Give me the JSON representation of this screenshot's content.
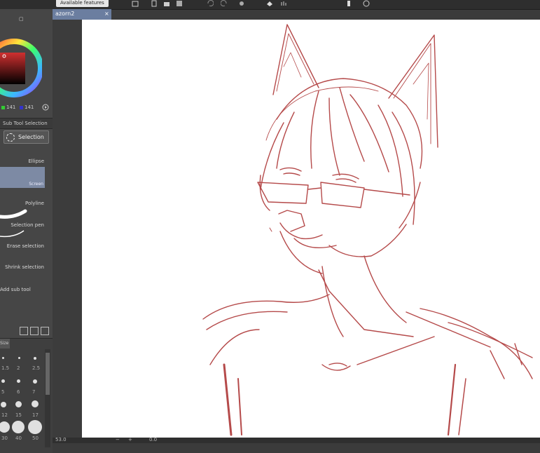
{
  "topbar": {
    "available_features": "Available features"
  },
  "color": {
    "r": "",
    "g": "141",
    "b": "141"
  },
  "tabs": {
    "sub_tool_selection": "Sub Tool Selection"
  },
  "subtool": {
    "selection_button": "Selection",
    "items": [
      "Ellipse",
      "Polyline",
      "Selection pen",
      "Erase selection",
      "Shrink selection"
    ],
    "ellipse_sublabel": "Screen",
    "add_sub_tool": "Add sub tool"
  },
  "brush_size": {
    "tab": "Size",
    "rows": [
      [
        "1.5",
        "2",
        "2.5"
      ],
      [
        "5",
        "6",
        "7"
      ],
      [
        "12",
        "15",
        "17"
      ],
      [
        "30",
        "40",
        "50"
      ]
    ]
  },
  "document": {
    "tab_name": "azorn2"
  },
  "status": {
    "zoom": "53.0",
    "angle": "0.0"
  }
}
